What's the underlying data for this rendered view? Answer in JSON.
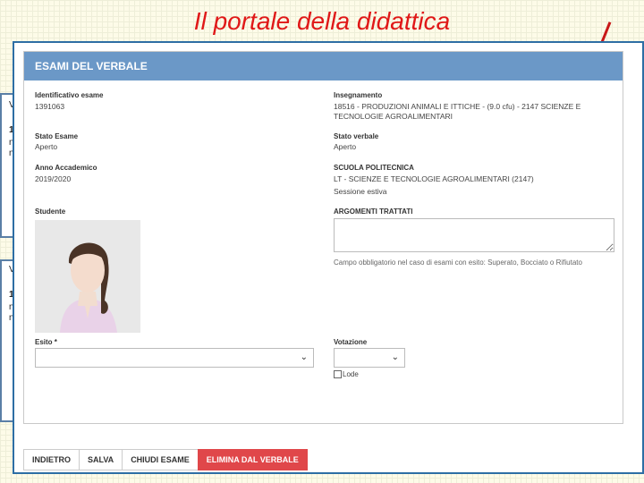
{
  "slide": {
    "title": "Il portale della didattica"
  },
  "background_fragments": {
    "panel1": [
      "V",
      "1",
      "n",
      "n"
    ],
    "panel2": [
      "V",
      "1",
      "n",
      "n"
    ]
  },
  "modal": {
    "title": "ESAMI DEL VERBALE",
    "fields": {
      "identificativo_label": "Identificativo esame",
      "identificativo_value": "1391063",
      "insegnamento_label": "Insegnamento",
      "insegnamento_value": "18516 - PRODUZIONI ANIMALI E ITTICHE - (9.0 cfu) - 2147 SCIENZE E TECNOLOGIE AGROALIMENTARI",
      "stato_esame_label": "Stato Esame",
      "stato_esame_value": "Aperto",
      "stato_verbale_label": "Stato verbale",
      "stato_verbale_value": "Aperto",
      "anno_label": "Anno Accademico",
      "anno_value": "2019/2020",
      "scuola_label": "SCUOLA POLITECNICA",
      "scuola_value": "LT - SCIENZE E TECNOLOGIE AGROALIMENTARI (2147)",
      "sessione_value": "Sessione estiva",
      "studente_label": "Studente",
      "argomenti_label": "ARGOMENTI TRATTATI",
      "argomenti_value": "",
      "argomenti_note": "Campo obbligatorio nel caso di esami con esito: Superato, Bocciato o Rifiutato",
      "esito_label": "Esito *",
      "esito_value": "",
      "votazione_label": "Votazione",
      "votazione_value": "",
      "lode_label": "Lode"
    }
  },
  "footer": {
    "buttons": [
      "INDIETRO",
      "SALVA",
      "CHIUDI ESAME",
      "ELIMINA DAL VERBALE"
    ]
  },
  "colors": {
    "header": "#6b98c7",
    "danger": "#e0474a",
    "frame": "#2d6ea4",
    "title": "#e01818"
  },
  "icons": [
    "chevron-down-icon",
    "checkbox-icon",
    "resize-grip-icon"
  ]
}
